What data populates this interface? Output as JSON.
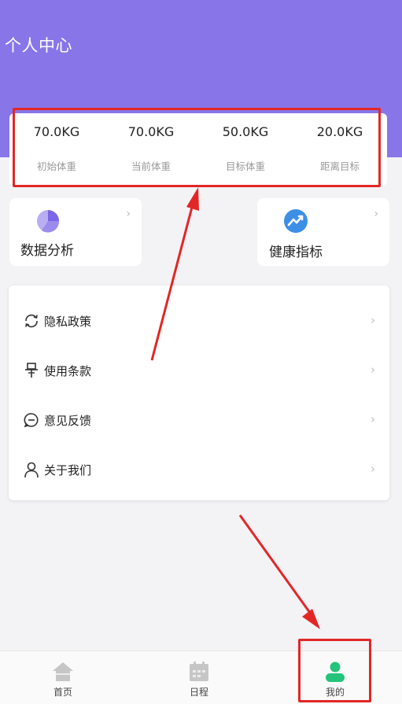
{
  "header": {
    "title": "个人中心",
    "color": "#8875e8"
  },
  "stats": [
    {
      "value": "70.0KG",
      "label": "初始体重"
    },
    {
      "value": "70.0KG",
      "label": "当前体重"
    },
    {
      "value": "50.0KG",
      "label": "目标体重"
    },
    {
      "value": "20.0KG",
      "label": "距离目标"
    }
  ],
  "quick_actions": [
    {
      "label": "数据分析",
      "icon": "pie-chart-icon"
    },
    {
      "label": "健康指标",
      "icon": "trend-icon"
    }
  ],
  "menu": [
    {
      "label": "隐私政策",
      "icon": "refresh-icon"
    },
    {
      "label": "使用条款",
      "icon": "pin-icon"
    },
    {
      "label": "意见反馈",
      "icon": "chat-icon"
    },
    {
      "label": "关于我们",
      "icon": "person-icon"
    }
  ],
  "nav": [
    {
      "label": "首页",
      "icon": "home-icon"
    },
    {
      "label": "日程",
      "icon": "calendar-icon"
    },
    {
      "label": "我的",
      "icon": "user-icon",
      "active": true
    }
  ],
  "annotation_color": "#e32626",
  "active_color": "#23c47a"
}
